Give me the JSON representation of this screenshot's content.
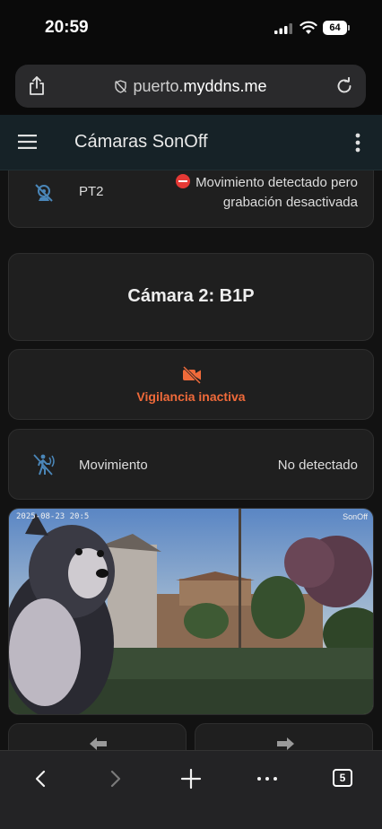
{
  "status_bar": {
    "time": "20:59",
    "battery": "64"
  },
  "browser": {
    "url_prefix": "puerto.",
    "url_domain": "myddns.me"
  },
  "header": {
    "title": "Cámaras SonOff"
  },
  "pt2_card": {
    "label": "PT2",
    "status": "Movimiento detectado pero grabación desactivada"
  },
  "camera2": {
    "title": "Cámara 2: B1P",
    "surveillance_status": "Vigilancia inactiva",
    "motion_label": "Movimiento",
    "motion_value": "No detectado",
    "feed_timestamp": "2025-08-23 20:5",
    "feed_brand": "SonOff"
  },
  "toolbar": {
    "tabs_count": "5"
  },
  "colors": {
    "accent": "#ef6a3a",
    "icon_blue": "#4a86b8",
    "header_bg": "#162227"
  },
  "icons": [
    "share-icon",
    "reload-icon",
    "menu-icon",
    "more-icon",
    "videocam-off-icon",
    "motion-icon",
    "arrow-left-icon",
    "arrow-right-icon",
    "back-icon",
    "forward-icon",
    "add-icon",
    "ellipsis-icon",
    "tabs-icon"
  ]
}
